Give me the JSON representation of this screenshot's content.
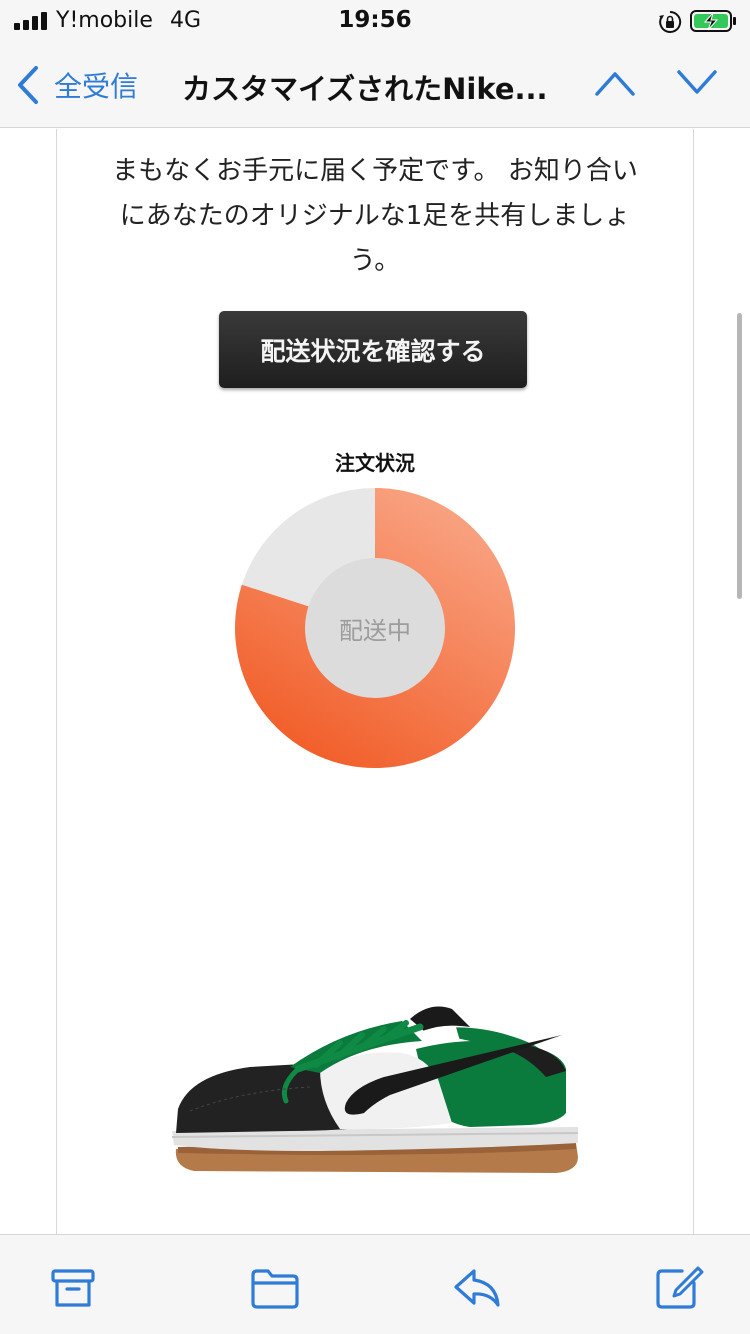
{
  "status_bar": {
    "carrier": "Y!mobile",
    "network": "4G",
    "time": "19:56",
    "icons": [
      "signal-icon",
      "orientation-lock-icon",
      "battery-charging-icon"
    ]
  },
  "nav": {
    "back_label": "全受信",
    "title": "カスタマイズされたNike...",
    "icons": [
      "chevron-left-icon",
      "chevron-up-icon",
      "chevron-down-icon"
    ]
  },
  "email": {
    "body_lines": [
      "まもなくお手元に届く予定です。 お知り合い",
      "にあなたのオリジナルな1足を共有しましょ",
      "う。"
    ],
    "track_button_label": "配送状況を確認する",
    "order_status": {
      "title": "注文状況",
      "center_label": "配送中",
      "progress_fraction": 0.8,
      "colors": {
        "progress_start": "#f9a787",
        "progress_end": "#f15a24",
        "remaining": "#e7e7e7",
        "center": "#dcdcdc"
      }
    },
    "product_image": "nike-dunk-low-custom-shoe"
  },
  "toolbar": {
    "icons": [
      "archive-icon",
      "folder-icon",
      "reply-icon",
      "compose-icon"
    ]
  },
  "colors": {
    "accent": "#2f7bd8",
    "bars": "#f6f6f6",
    "button": "#262626"
  }
}
